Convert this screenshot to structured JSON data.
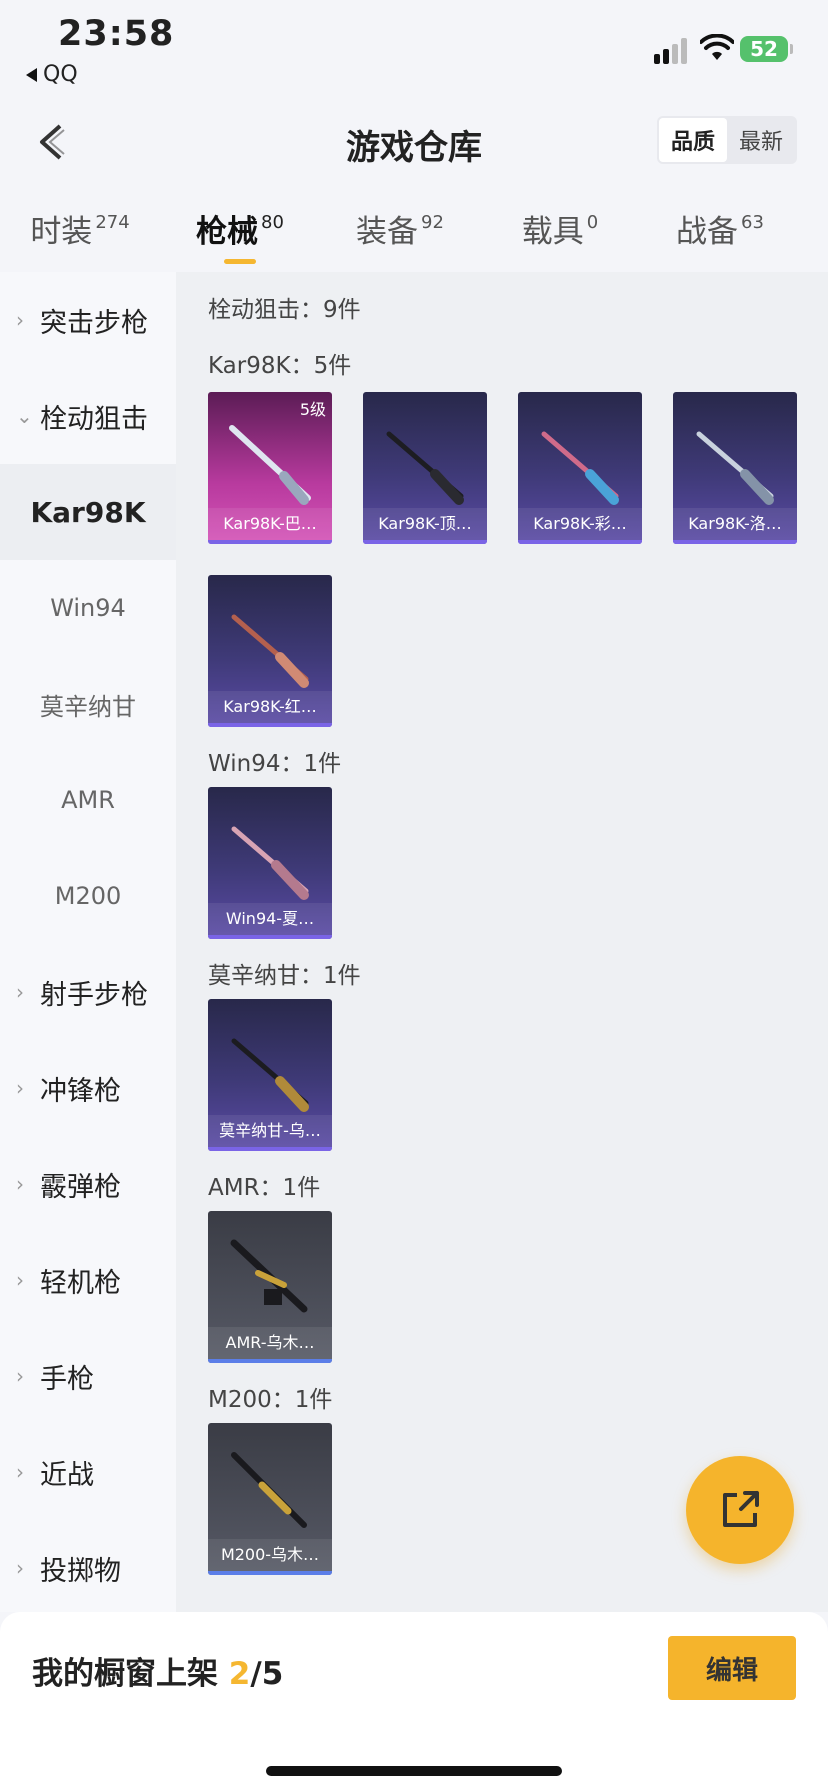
{
  "status": {
    "time": "23:58",
    "back_app": "QQ",
    "battery": "52"
  },
  "header": {
    "title": "游戏仓库",
    "sort_options": [
      "品质",
      "最新"
    ],
    "sort_active": "品质"
  },
  "tabs": [
    {
      "label": "时装",
      "count": "274"
    },
    {
      "label": "枪械",
      "count": "80"
    },
    {
      "label": "装备",
      "count": "92"
    },
    {
      "label": "载具",
      "count": "0"
    },
    {
      "label": "战备",
      "count": "63"
    }
  ],
  "sidebar": {
    "categories": [
      "突击步枪",
      "栓动狙击",
      "射手步枪",
      "冲锋枪",
      "霰弹枪",
      "轻机枪",
      "手枪",
      "近战",
      "投掷物"
    ],
    "sub": [
      "Kar98K",
      "Win94",
      "莫辛纳甘",
      "AMR",
      "M200"
    ]
  },
  "main": {
    "group_title": "栓动狙击：9件",
    "sections": [
      {
        "title": "Kar98K：5件"
      },
      {
        "title": "Win94：1件"
      },
      {
        "title": "莫辛纳甘：1件"
      },
      {
        "title": "AMR：1件"
      },
      {
        "title": "M200：1件"
      }
    ],
    "items": [
      {
        "name": "Kar98K-巴…",
        "level": "5级",
        "rarity": "pink"
      },
      {
        "name": "Kar98K-顶…",
        "rarity": "purple"
      },
      {
        "name": "Kar98K-彩…",
        "rarity": "purple"
      },
      {
        "name": "Kar98K-洛…",
        "rarity": "purple"
      },
      {
        "name": "Kar98K-红…",
        "rarity": "purple"
      },
      {
        "name": "Win94-夏…",
        "rarity": "purple"
      },
      {
        "name": "莫辛纳甘-乌…",
        "rarity": "purple"
      },
      {
        "name": "AMR-乌木…",
        "rarity": "gray"
      },
      {
        "name": "M200-乌木…",
        "rarity": "gray"
      }
    ]
  },
  "footer": {
    "shelf_label": "我的橱窗上架 ",
    "shelf_current": "2",
    "shelf_total": "/5",
    "edit_label": "编辑"
  },
  "colors": {
    "accent": "#f5b42c",
    "purple_bar": "#7a64e6"
  }
}
